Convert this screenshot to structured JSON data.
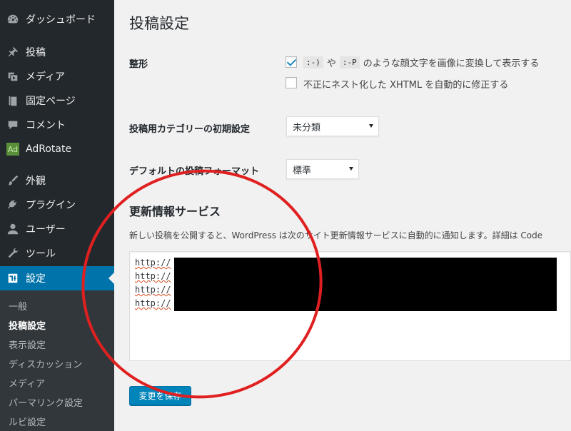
{
  "sidebar": {
    "items": [
      {
        "label": "ダッシュボード",
        "icon": "dashboard-icon"
      },
      {
        "label": "投稿",
        "icon": "pushpin-icon"
      },
      {
        "label": "メディア",
        "icon": "media-icon"
      },
      {
        "label": "固定ページ",
        "icon": "page-icon"
      },
      {
        "label": "コメント",
        "icon": "comment-icon"
      },
      {
        "label": "AdRotate",
        "icon": "adrotate-icon",
        "icon_text": "Ad"
      },
      {
        "label": "外観",
        "icon": "brush-icon"
      },
      {
        "label": "プラグイン",
        "icon": "plugin-icon"
      },
      {
        "label": "ユーザー",
        "icon": "user-icon"
      },
      {
        "label": "ツール",
        "icon": "wrench-icon"
      },
      {
        "label": "設定",
        "icon": "settings-icon",
        "active": true
      }
    ],
    "submenu": [
      "一般",
      "投稿設定",
      "表示設定",
      "ディスカッション",
      "メディア",
      "パーマリンク設定",
      "ルビ設定"
    ],
    "current_submenu": "投稿設定"
  },
  "main": {
    "title": "投稿設定",
    "formatting": {
      "label": "整形",
      "smilies": {
        "checked": true,
        "code1": ":-)",
        "mid": "や",
        "code2": ":-P",
        "text": "のような顔文字を画像に変換して表示する"
      },
      "xhtml": {
        "checked": false,
        "text": "不正にネスト化した XHTML を自動的に修正する"
      }
    },
    "default_category": {
      "label": "投稿用カテゴリーの初期設定",
      "value": "未分類"
    },
    "default_format": {
      "label": "デフォルトの投稿フォーマット",
      "value": "標準"
    },
    "update_services": {
      "heading": "更新情報サービス",
      "description": "新しい投稿を公開すると、WordPress は次のサイト更新情報サービスに自動的に通知します。詳細は Code",
      "lines": [
        "http://",
        "http://",
        "http://",
        "http://"
      ]
    },
    "save_button": "変更を保存"
  },
  "colors": {
    "sidebar_bg": "#23282d",
    "active": "#0073aa",
    "button": "#0085ba",
    "annotation": "#e02020"
  }
}
